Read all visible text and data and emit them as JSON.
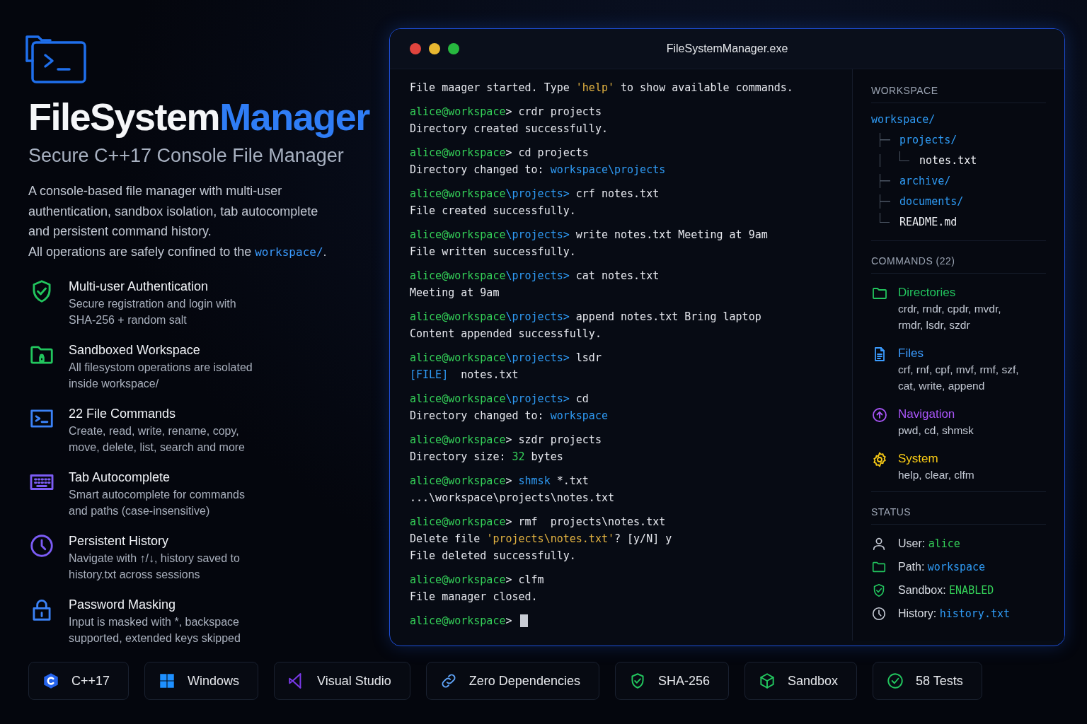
{
  "hero": {
    "title_main": "FileSystem",
    "title_accent": "Manager",
    "subtitle": "Secure C++17 Console File Manager",
    "description": "A console-based file manager with multi-user authentication, sandbox isolation, tab autocomplete and persistent command history.",
    "note": {
      "text": "All operations are safely confined to the ",
      "path": "workspace/",
      "end": "."
    }
  },
  "features": [
    {
      "kind": "shield-check",
      "color": "#22c55e",
      "title": "Multi-user Authentication",
      "text": "Secure registration and login with SHA-256 + random salt"
    },
    {
      "kind": "folder-lock",
      "color": "#22c55e",
      "title": "Sandboxed Workspace",
      "text": "All filesystom operations are isolated inside workspace/"
    },
    {
      "kind": "terminal",
      "color": "#3b82f6",
      "title": "22 File Commands",
      "text": "Create, read, write, rename, copy, move, delete, list, search and more"
    },
    {
      "kind": "keyboard",
      "color": "#7c5cf5",
      "title": "Tab Autocomplete",
      "text": "Smart autocomplete for commands and paths (case-insensitive)"
    },
    {
      "kind": "clock",
      "color": "#7c5cf5",
      "title": "Persistent History",
      "text": "Navigate with ↑/↓, history saved to history.txt across sessions"
    },
    {
      "kind": "lock",
      "color": "#3b82f6",
      "title": "Password Masking",
      "text": "Input is masked with *, backspace supported, extended keys skipped"
    }
  ],
  "window": {
    "title": "FileSystemManager.exe"
  },
  "terminal": {
    "cursor": true,
    "blocks": [
      [
        [
          {
            "kind": "plain",
            "t": "File maager started. Type "
          },
          {
            "kind": "quote",
            "t": "'help'"
          },
          {
            "kind": "plain",
            "t": " to show available commands."
          }
        ]
      ],
      [
        [
          {
            "kind": "user",
            "t": "alice@workspace"
          },
          {
            "kind": "plain",
            "t": "> crdr projects"
          }
        ],
        [
          {
            "kind": "plain",
            "t": "Directory created successfully."
          }
        ]
      ],
      [
        [
          {
            "kind": "user",
            "t": "alice@workspace"
          },
          {
            "kind": "plain",
            "t": "> cd projects"
          }
        ],
        [
          {
            "kind": "plain",
            "t": "Directory changed to: "
          },
          {
            "kind": "link",
            "t": "workspace\\projects"
          }
        ]
      ],
      [
        [
          {
            "kind": "user",
            "t": "alice@workspace"
          },
          {
            "kind": "link",
            "t": "\\projects>"
          },
          {
            "kind": "plain",
            "t": " crf notes.txt"
          }
        ],
        [
          {
            "kind": "plain",
            "t": "File created successfully."
          }
        ]
      ],
      [
        [
          {
            "kind": "user",
            "t": "alice@workspace"
          },
          {
            "kind": "link",
            "t": "\\projects>"
          },
          {
            "kind": "plain",
            "t": " write notes.txt Meeting at 9am"
          }
        ],
        [
          {
            "kind": "plain",
            "t": "File written successfully."
          }
        ]
      ],
      [
        [
          {
            "kind": "user",
            "t": "alice@workspace"
          },
          {
            "kind": "link",
            "t": "\\projects>"
          },
          {
            "kind": "plain",
            "t": " cat notes.txt"
          }
        ],
        [
          {
            "kind": "plain",
            "t": "Meeting at 9am"
          }
        ]
      ],
      [
        [
          {
            "kind": "user",
            "t": "alice@workspace"
          },
          {
            "kind": "link",
            "t": "\\projects>"
          },
          {
            "kind": "plain",
            "t": " append notes.txt Bring laptop"
          }
        ],
        [
          {
            "kind": "plain",
            "t": "Content appended successfully."
          }
        ]
      ],
      [
        [
          {
            "kind": "user",
            "t": "alice@workspace"
          },
          {
            "kind": "link",
            "t": "\\projects>"
          },
          {
            "kind": "plain",
            "t": " lsdr"
          }
        ],
        [
          {
            "kind": "link",
            "t": "[FILE]"
          },
          {
            "kind": "plain",
            "t": "  notes.txt"
          }
        ]
      ],
      [
        [
          {
            "kind": "user",
            "t": "alice@workspace"
          },
          {
            "kind": "link",
            "t": "\\projects>"
          },
          {
            "kind": "plain",
            "t": " cd"
          }
        ],
        [
          {
            "kind": "plain",
            "t": "Directory changed to: "
          },
          {
            "kind": "link",
            "t": "workspace"
          }
        ]
      ],
      [
        [
          {
            "kind": "user",
            "t": "alice@workspace"
          },
          {
            "kind": "plain",
            "t": "> szdr projects"
          }
        ],
        [
          {
            "kind": "plain",
            "t": "Directory size: "
          },
          {
            "kind": "num",
            "t": "32"
          },
          {
            "kind": "plain",
            "t": " bytes"
          }
        ]
      ],
      [
        [
          {
            "kind": "user",
            "t": "alice@workspace"
          },
          {
            "kind": "plain",
            "t": "> "
          },
          {
            "kind": "link",
            "t": "shmsk"
          },
          {
            "kind": "plain",
            "t": " *.txt"
          }
        ],
        [
          {
            "kind": "plain",
            "t": "...\\workspace\\projects\\notes.txt"
          }
        ]
      ],
      [
        [
          {
            "kind": "user",
            "t": "alice@workspace"
          },
          {
            "kind": "plain",
            "t": "> rmf  projects\\notes.txt"
          }
        ],
        [
          {
            "kind": "plain",
            "t": "Delete file "
          },
          {
            "kind": "quote",
            "t": "'projects\\notes.txt'"
          },
          {
            "kind": "plain",
            "t": "? [y/N] y"
          }
        ],
        [
          {
            "kind": "plain",
            "t": "File deleted successfully."
          }
        ]
      ],
      [
        [
          {
            "kind": "user",
            "t": "alice@workspace"
          },
          {
            "kind": "plain",
            "t": "> clfm"
          }
        ],
        [
          {
            "kind": "plain",
            "t": "File manager closed."
          }
        ]
      ],
      [
        [
          {
            "kind": "user",
            "t": "alice@workspace"
          },
          {
            "kind": "plain",
            "t": ">"
          }
        ]
      ]
    ]
  },
  "sidebar": {
    "workspace": {
      "heading": "WORKSPACE",
      "tree": {
        "name": "workspace/",
        "kind": "dir",
        "children": [
          {
            "name": "projects/",
            "kind": "dir",
            "children": [
              {
                "name": "notes.txt",
                "kind": "file"
              }
            ]
          },
          {
            "name": "archive/",
            "kind": "dir"
          },
          {
            "name": "documents/",
            "kind": "dir"
          },
          {
            "name": "README.md",
            "kind": "file"
          }
        ]
      }
    },
    "commands": {
      "heading": "COMMANDS (22)",
      "groups": [
        {
          "kind": "folder",
          "color": "#22c55e",
          "title": "Directories",
          "items": "crdr, rndr, cpdr, mvdr, rmdr, lsdr, szdr"
        },
        {
          "kind": "file",
          "color": "#3b9cff",
          "title": "Files",
          "items": "crf, rnf, cpf, mvf, rmf, szf, cat, write, append"
        },
        {
          "kind": "arrow-circle",
          "color": "#a855f7",
          "title": "Navigation",
          "items": "pwd, cd, shmsk"
        },
        {
          "kind": "gear",
          "color": "#facc15",
          "title": "System",
          "items": "help, clear, clfm"
        }
      ]
    },
    "status": {
      "heading": "STATUS",
      "items": [
        {
          "kind": "user",
          "label": "User:",
          "value": "alice"
        },
        {
          "kind": "folder",
          "label": "Path:",
          "value": "workspace"
        },
        {
          "kind": "shield",
          "label": "Sandbox:",
          "value": "ENABLED"
        },
        {
          "kind": "history",
          "label": "History:",
          "value": "history.txt"
        }
      ]
    }
  },
  "badges": [
    {
      "kind": "cpp",
      "label": "C++17"
    },
    {
      "kind": "windows",
      "label": "Windows"
    },
    {
      "kind": "vs",
      "label": "Visual Studio"
    },
    {
      "kind": "link",
      "label": "Zero Dependencies"
    },
    {
      "kind": "shield-check",
      "label": "SHA-256"
    },
    {
      "kind": "cube",
      "label": "Sandbox"
    },
    {
      "kind": "check-circle",
      "label": "58 Tests"
    }
  ]
}
